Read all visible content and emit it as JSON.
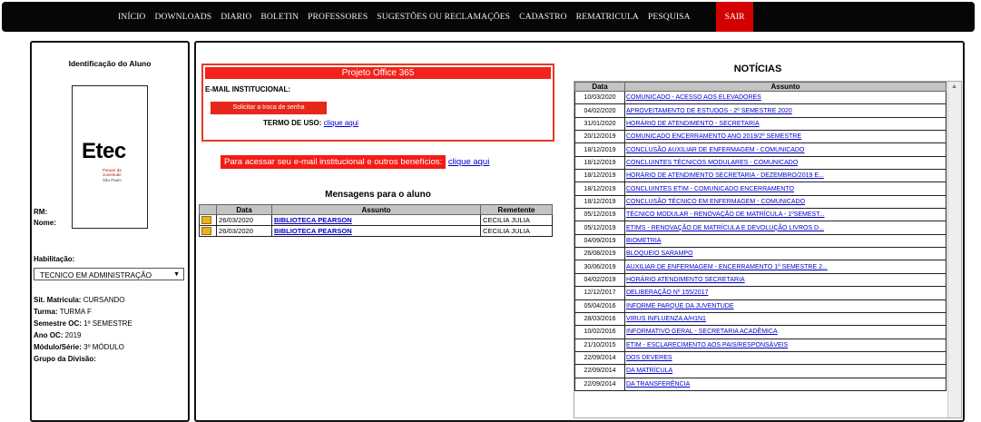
{
  "nav": {
    "items": [
      "INÍCIO",
      "DOWNLOADS",
      "DIARIO",
      "BOLETIN",
      "PROFESSORES",
      "SUGESTÕES OU RECLAMAÇÕES",
      "CADASTRO",
      "REMATRICULA",
      "PESQUISA"
    ],
    "sair": "SAIR"
  },
  "aluno": {
    "title": "Identificação do Aluno",
    "logo_text": "Etec",
    "logo_sub": "Parque da Juventude",
    "logo_sub2": "São Paulo",
    "rm_label": "RM:",
    "rm_value": "",
    "nome_label": "Nome:",
    "nome_value": "",
    "habilitacao_label": "Habilitação:",
    "habilitacao_value": "TECNICO EM ADMINISTRAÇÃO",
    "sit_label": "Sit. Matricula:",
    "sit_value": "CURSANDO",
    "turma_label": "Turma:",
    "turma_value": "TURMA F",
    "semestre_label": "Semestre OC:",
    "semestre_value": "1º SEMESTRE",
    "ano_label": "Ano OC:",
    "ano_value": "2019",
    "modulo_label": "Módulo/Série:",
    "modulo_value": "3º MÓDULO",
    "grupo_label": "Grupo da Divisão:",
    "grupo_value": ""
  },
  "office": {
    "title": "Projeto Office 365",
    "email_label": "E-MAIL INSTITUCIONAL:",
    "email_value": "",
    "btn_label": "Solicitar a troca de senha",
    "termo_label": "TERMO DE USO:",
    "termo_link": "clique aqui"
  },
  "access": {
    "text": "Para acessar seu e-mail institucional e outros benefícios:",
    "link": "clique aqui"
  },
  "mensagens": {
    "title": "Mensagens para o aluno",
    "headers": [
      "Data",
      "Assunto",
      "Remetente"
    ],
    "rows": [
      {
        "data": "26/03/2020",
        "assunto": "BIBLIOTECA PEARSON",
        "remetente": "CECILIA JULIA"
      },
      {
        "data": "26/03/2020",
        "assunto": "BIBLIOTECA PEARSON",
        "remetente": "CECILIA JULIA"
      }
    ]
  },
  "noticias": {
    "title": "NOTÍCIAS",
    "headers": [
      "Data",
      "Assunto"
    ],
    "rows": [
      {
        "data": "10/03/2020",
        "assunto": "COMUNICADO - ACESSO AOS ELEVADORES"
      },
      {
        "data": "04/02/2020",
        "assunto": "APROVEITAMENTO DE ESTUDOS - 2º SEMESTRE 2020"
      },
      {
        "data": "31/01/2020",
        "assunto": "HORÁRIO DE ATENDIMENTO - SECRETARIA"
      },
      {
        "data": "20/12/2019",
        "assunto": "COMUNICADO ENCERRAMENTO ANO 2019/2º SEMESTRE"
      },
      {
        "data": "18/12/2019",
        "assunto": "CONCLUSÃO AUXILIAR DE ENFERMAGEM - COMUNICADO"
      },
      {
        "data": "18/12/2019",
        "assunto": "CONCLUINTES TÉCNICOS MODULARES - COMUNICADO"
      },
      {
        "data": "18/12/2019",
        "assunto": "HORÁRIO DE ATENDIMENTO SECRETARIA - DEZEMBRO/2019 E..."
      },
      {
        "data": "18/12/2019",
        "assunto": "CONCLUINTES ETIM - COMUNICADO ENCERRAMENTO"
      },
      {
        "data": "18/12/2019",
        "assunto": "CONCLUSÃO TÉCNICO EM ENFERMAGEM - COMUNICADO"
      },
      {
        "data": "05/12/2019",
        "assunto": "TÉCNICO MODULAR - RENOVAÇÃO DE MATRÍCULA - 1ºSEMEST..."
      },
      {
        "data": "05/12/2019",
        "assunto": "ETIMS - RENOVAÇÃO DE MATRÍCULA E DEVOLUÇÃO LIVROS D..."
      },
      {
        "data": "04/09/2019",
        "assunto": "BIOMETRIA"
      },
      {
        "data": "26/08/2019",
        "assunto": "BLOQUEIO SARAMPO"
      },
      {
        "data": "30/06/2019",
        "assunto": "AUXILIAR DE ENFERMAGEM - ENCERRAMENTO 1º SEMESTRE 2..."
      },
      {
        "data": "04/02/2019",
        "assunto": "HORÁRIO ATENDIMENTO SECRETARIA"
      },
      {
        "data": "12/12/2017",
        "assunto": "DELIBERAÇÃO Nº 155/2017"
      },
      {
        "data": "05/04/2016",
        "assunto": "INFORME PARQUE DA JUVENTUDE"
      },
      {
        "data": "28/03/2016",
        "assunto": "VIRUS INFLUENZA A/H1N1"
      },
      {
        "data": "10/02/2016",
        "assunto": "INFORMATIVO GERAL - SECRETARIA ACADÊMICA"
      },
      {
        "data": "21/10/2015",
        "assunto": "ETIM - ESCLARECIMENTO AOS PAIS/RESPONSÁVEIS"
      },
      {
        "data": "22/09/2014",
        "assunto": "DOS DEVERES"
      },
      {
        "data": "22/09/2014",
        "assunto": "DA MATRÍCULA"
      },
      {
        "data": "22/09/2014",
        "assunto": "DA TRANSFERÊNCIA"
      }
    ]
  }
}
